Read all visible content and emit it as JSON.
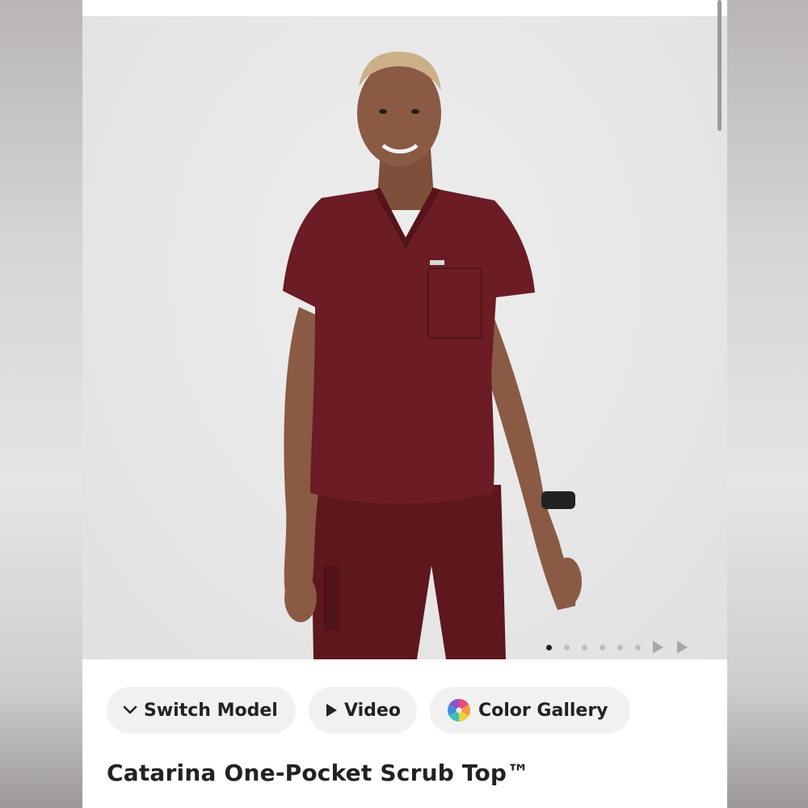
{
  "product": {
    "title": "Catarina One-Pocket Scrub Top™",
    "image_alt_color": "#6b1c24"
  },
  "actions": {
    "switch_model_label": "Switch Model",
    "video_label": "Video",
    "color_gallery_label": "Color Gallery"
  },
  "carousel": {
    "current_index": 1,
    "total_dots": 6
  },
  "colors": {
    "scrub": "#6b1c24",
    "scrub_dark": "#561419",
    "skin": "#8a5a44",
    "background": "#e8e8e8"
  }
}
